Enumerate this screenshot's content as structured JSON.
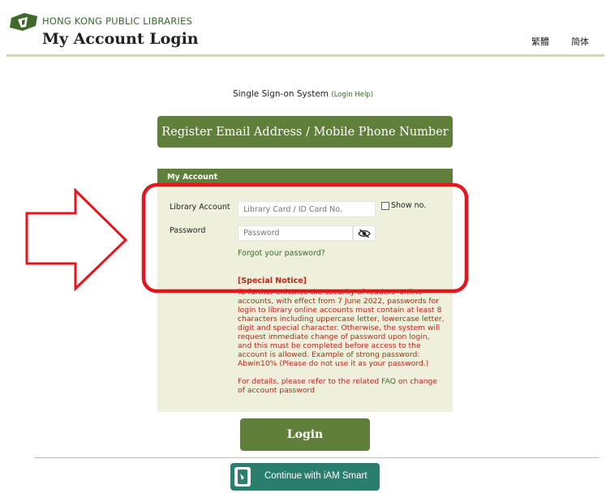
{
  "header": {
    "org_name": "HONG KONG PUBLIC LIBRARIES",
    "title": "My Account Login",
    "lang_traditional": "繁體",
    "lang_simplified": "简体"
  },
  "sso": {
    "text": "Single Sign-on System",
    "help": "(Login Help)"
  },
  "register_button": "Register Email Address / Mobile Phone Number",
  "account_panel": {
    "heading": "My Account",
    "library_account_label": "Library Account",
    "library_account_placeholder": "Library Card / ID Card No.",
    "show_no_label": "Show no.",
    "password_label": "Password",
    "password_placeholder": "Password",
    "forgot_password": "Forgot your password?",
    "notice_title": "[Special Notice]",
    "notice_body": "To further enhance the security of readers' online accounts, with effect from 7 June 2022, passwords for login to library online accounts must contain at least 8 characters including uppercase letter, lowercase letter, digit and special character. Otherwise, the system will request immediate change of password upon login, and this must be completed before access to the account is allowed. Example of strong password: Abwin10% (Please do not use it as your password.)",
    "details_prefix": "For details, please refer to the related ",
    "details_link": "FAQ",
    "details_suffix": " on change of account password"
  },
  "login_button": "Login",
  "iam_smart_button": "Continue with iAM Smart",
  "colors": {
    "brand_green": "#5f7f3a",
    "notice_red": "#b3291d",
    "iam_teal": "#2a7e6e",
    "annotation_red": "#e8141b"
  },
  "icons": [
    "hkpl-logo-icon",
    "eye-slash-icon",
    "iam-smart-icon",
    "arrow-annotation"
  ]
}
